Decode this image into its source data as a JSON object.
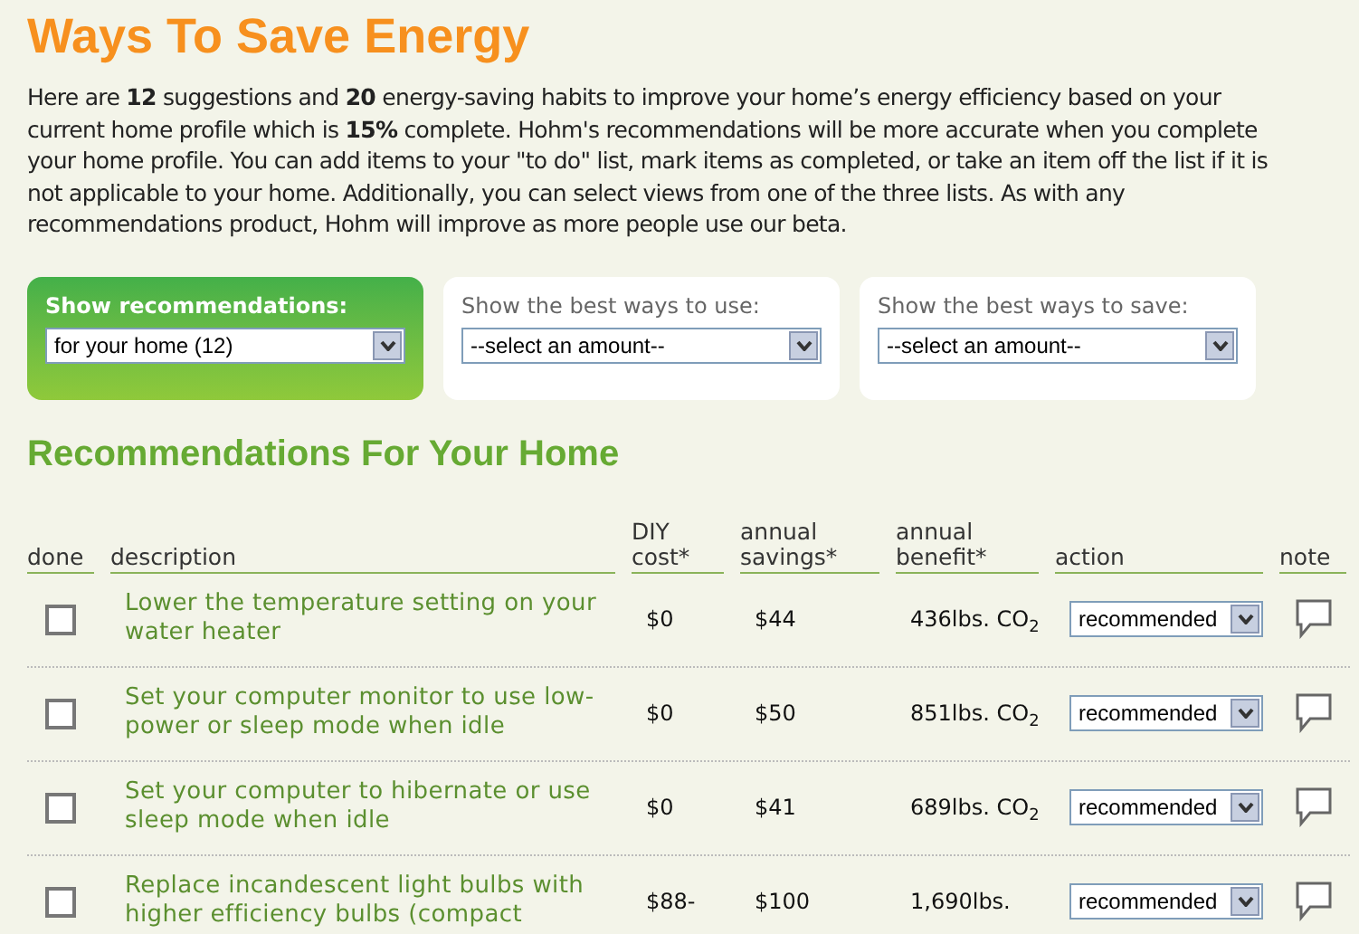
{
  "title": "Ways To Save Energy",
  "intro": "Here are **12** suggestions and **20** energy-saving habits to improve your home’s energy efficiency based on your current home profile which is **15%** complete. Hohm's recommendations will be more accurate when you complete your home profile. You can add items to your \"to do\" list, mark items as completed, or take an item off the list if it is not applicable to your home. Additionally, you can select views from one of the three lists. As with any recommendations product, Hohm will improve as more people use our beta.",
  "filters": [
    {
      "label": "Show recommendations:",
      "value": "for your home (12)",
      "selected": true
    },
    {
      "label": "Show the best ways to use:",
      "value": "--select an amount--",
      "selected": false
    },
    {
      "label": "Show the best ways to save:",
      "value": "--select an amount--",
      "selected": false
    }
  ],
  "section_title": "Recommendations For Your Home",
  "table": {
    "columns": [
      "done",
      "description",
      "DIY cost*",
      "annual savings*",
      "annual benefit*",
      "action",
      "note"
    ],
    "rows": [
      {
        "done": false,
        "description": "Lower the temperature setting on your water heater",
        "cost": "$0",
        "savings": "$44",
        "benefit": "436lbs. CO$_{2}$",
        "action": "recommended"
      },
      {
        "done": false,
        "description": "Set your computer monitor to use low-power or sleep mode when idle",
        "cost": "$0",
        "savings": "$50",
        "benefit": "851lbs. CO$_{2}$",
        "action": "recommended"
      },
      {
        "done": false,
        "description": "Set your computer to hibernate or use sleep mode when idle",
        "cost": "$0",
        "savings": "$41",
        "benefit": "689lbs. CO$_{2}$",
        "action": "recommended"
      },
      {
        "done": false,
        "description": "Replace incandescent light bulbs with higher efficiency bulbs (compact",
        "cost": "$88-",
        "savings": "$100",
        "benefit": "1,690lbs.",
        "action": "recommended"
      }
    ]
  }
}
